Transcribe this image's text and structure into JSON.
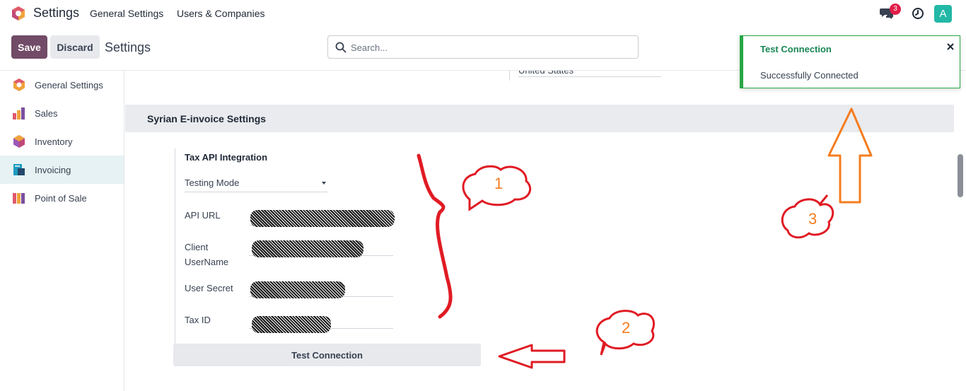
{
  "navbar": {
    "app_title": "Settings",
    "menu": [
      "General Settings",
      "Users & Companies"
    ],
    "chat_badge": "3",
    "avatar_letter": "A",
    "colors": {
      "brand": "#714b67",
      "avatar": "#22b8a5",
      "badge": "#e11d48"
    }
  },
  "control_panel": {
    "save_label": "Save",
    "discard_label": "Discard",
    "breadcrumb": "Settings",
    "search_placeholder": "Search..."
  },
  "sidebar": {
    "items": [
      {
        "label": "General Settings",
        "icon": "odoo-logo-icon",
        "active": false
      },
      {
        "label": "Sales",
        "icon": "sales-chart-icon",
        "active": false
      },
      {
        "label": "Inventory",
        "icon": "inventory-box-icon",
        "active": false
      },
      {
        "label": "Invoicing",
        "icon": "invoicing-receipt-icon",
        "active": true
      },
      {
        "label": "Point of Sale",
        "icon": "pos-shop-icon",
        "active": false
      }
    ]
  },
  "main": {
    "country_value": "United States",
    "section_title": "Syrian E-invoice Settings",
    "setting_title": "Tax API Integration",
    "mode_value": "Testing Mode",
    "fields": [
      {
        "label": "API URL"
      },
      {
        "label_line1": "Client",
        "label_line2": "UserName"
      },
      {
        "label": "User Secret"
      },
      {
        "label": "Tax ID"
      }
    ],
    "test_button_label": "Test Connection"
  },
  "toast": {
    "title": "Test Connection",
    "message": "Successfully Connected",
    "color": "#28a745"
  },
  "annotations": {
    "labels": [
      "1",
      "2",
      "3"
    ],
    "colors": {
      "marker": "#e01b24",
      "arrow": "#f57c1f"
    }
  }
}
